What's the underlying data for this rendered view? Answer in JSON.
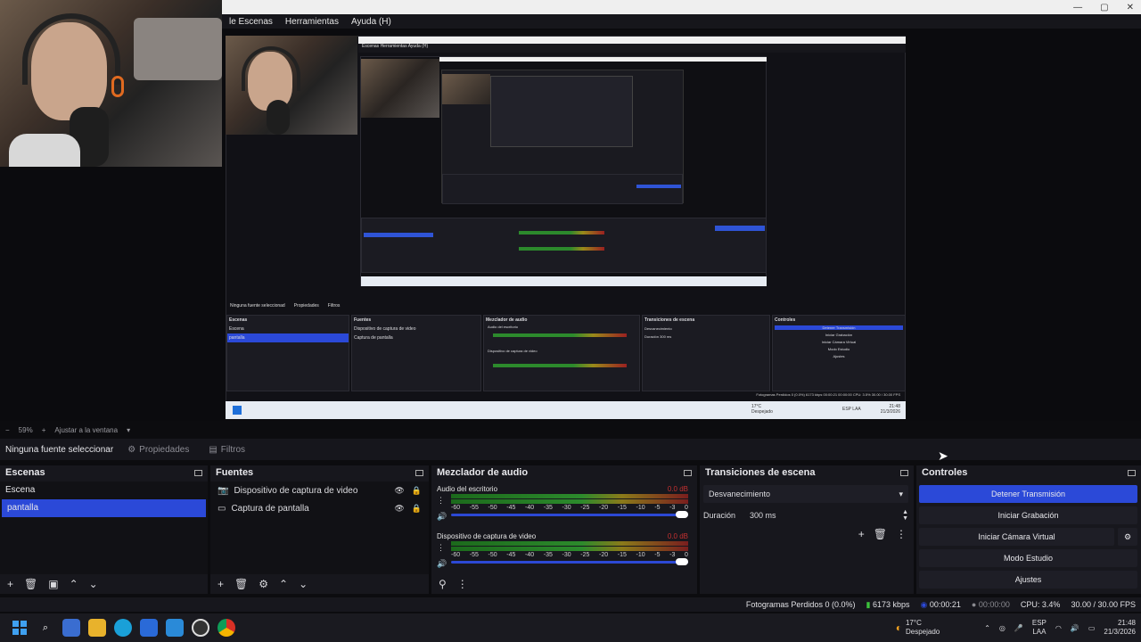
{
  "menu": {
    "items": [
      "le Escenas",
      "Herramientas",
      "Ayuda (H)"
    ]
  },
  "preview_nested": {
    "context_label": "Ninguna fuente seleccionad",
    "properties": "Propiedades",
    "filters": "Filtros",
    "docks": [
      "Escenas",
      "Fuentes",
      "Mezclador de audio",
      "Transiciones de escena",
      "Controles"
    ],
    "scenes": [
      "Escena",
      "pantalla"
    ],
    "sources": [
      "Dispositivo de captura de video",
      "Captura de pantalla"
    ],
    "channels": [
      "Audio del escritorio",
      "Dispositivo de captura de video"
    ],
    "transition": "Desvanecimiento",
    "duration_label": "Duración",
    "duration_value": "300 ms",
    "controls": [
      "Detener Transmisión",
      "Iniciar Grabación",
      "Iniciar Cámara Virtual",
      "Modo Estudio",
      "Ajustes"
    ],
    "status": "Fotogramas Perdidos 0 (0.0%)   6173 kbps   00:00:21   00:00:00   CPU: 3.5%   30.00 / 30.00 FPS",
    "weather_temp": "17°C",
    "weather_desc": "Despejado",
    "tray": "ESP LAA",
    "time": "21:48",
    "date": "21/3/2026"
  },
  "zoom": {
    "percent": "59%",
    "fit_label": "Ajustar a la ventana"
  },
  "context": {
    "no_source": "Ninguna fuente seleccionar",
    "properties": "Propiedades",
    "filters": "Filtros"
  },
  "scenes": {
    "title": "Escenas",
    "items": [
      "Escena",
      "pantalla"
    ],
    "selected": "pantalla"
  },
  "sources": {
    "title": "Fuentes",
    "items": [
      "Dispositivo de captura de video",
      "Captura de pantalla"
    ]
  },
  "mixer": {
    "title": "Mezclador de audio",
    "channels": [
      {
        "name": "Audio del escritorio",
        "db": "0.0 dB"
      },
      {
        "name": "Dispositivo de captura de video",
        "db": "0.0 dB"
      }
    ],
    "ticks": [
      "-60",
      "-55",
      "-50",
      "-45",
      "-40",
      "-35",
      "-30",
      "-25",
      "-20",
      "-15",
      "-10",
      "-5",
      "-3",
      "0"
    ]
  },
  "transitions": {
    "title": "Transiciones de escena",
    "selected": "Desvanecimiento",
    "duration_label": "Duración",
    "duration_value": "300 ms"
  },
  "controls": {
    "title": "Controles",
    "stop_stream": "Detener Transmisión",
    "start_recording": "Iniciar Grabación",
    "start_virtual_cam": "Iniciar Cámara Virtual",
    "studio_mode": "Modo Estudio",
    "settings": "Ajustes"
  },
  "status": {
    "dropped_frames": "Fotogramas Perdidos 0 (0.0%)",
    "bitrate": "6173 kbps",
    "stream_time": "00:00:21",
    "rec_time": "00:00:00",
    "cpu": "CPU: 3.4%",
    "fps": "30.00 / 30.00 FPS"
  },
  "taskbar": {
    "weather_temp": "17°C",
    "weather_desc": "Despejado",
    "lang_top": "ESP",
    "lang_bottom": "LAA",
    "time": "21:48",
    "date": "21/3/2026"
  },
  "colors": {
    "accent": "#2b49d8",
    "panel": "#17171d",
    "background": "#0c0c0f",
    "meter_red": "#c43030"
  }
}
